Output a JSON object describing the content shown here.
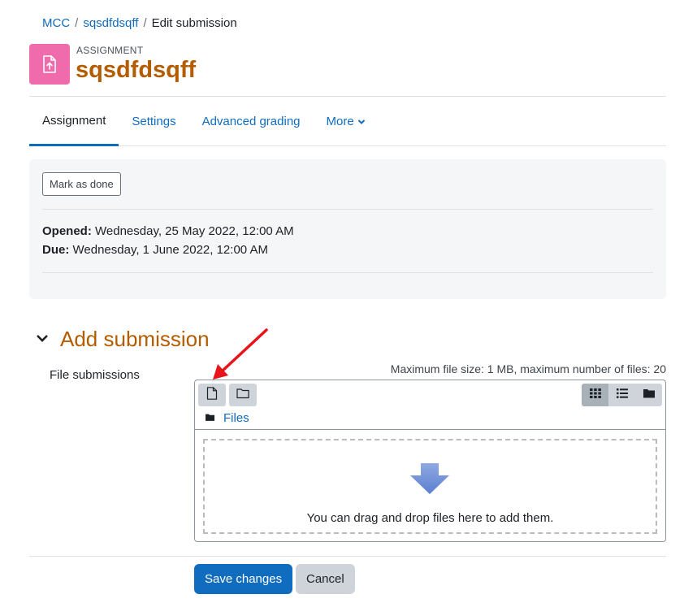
{
  "breadcrumb": {
    "items": [
      "MCC",
      "sqsdfdsqff",
      "Edit submission"
    ],
    "separator": "/"
  },
  "header": {
    "module_label": "ASSIGNMENT",
    "title": "sqsdfdsqff",
    "icon": "file-upload-icon",
    "icon_color": "#f06bab",
    "title_color": "#b35c00"
  },
  "tabs": [
    {
      "label": "Assignment",
      "active": true
    },
    {
      "label": "Settings",
      "active": false
    },
    {
      "label": "Advanced grading",
      "active": false
    },
    {
      "label": "More",
      "active": false
    }
  ],
  "activity": {
    "mark_done_label": "Mark as done",
    "opened_label": "Opened:",
    "opened_value": "Wednesday, 25 May 2022, 12:00 AM",
    "due_label": "Due:",
    "due_value": "Wednesday, 1 June 2022, 12:00 AM"
  },
  "submission": {
    "section_title": "Add submission",
    "field_label": "File submissions",
    "limits_text": "Maximum file size: 1 MB, maximum number of files: 20",
    "toolbar": {
      "add_file_icon": "file-icon",
      "create_folder_icon": "folder-outline-icon",
      "views": [
        "grid-icon",
        "list-icon",
        "folder-icon"
      ]
    },
    "path_label": "Files",
    "drop_text": "You can drag and drop files here to add them."
  },
  "buttons": {
    "save_label": "Save changes",
    "cancel_label": "Cancel"
  },
  "colors": {
    "link": "#0f6cbf",
    "primary": "#0f6cbf",
    "annotation_arrow": "#e8141b"
  }
}
